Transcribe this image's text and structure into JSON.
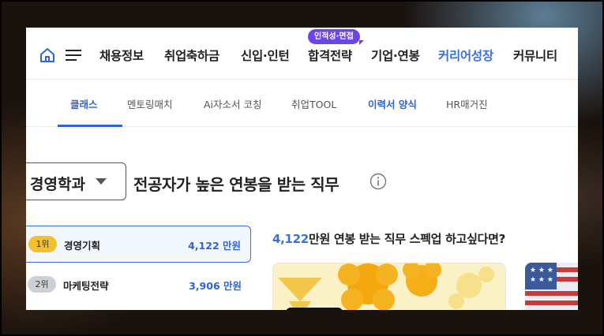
{
  "nav": {
    "items": [
      "채용정보",
      "취업축하금",
      "신입·인턴",
      "합격전략",
      "기업·연봉",
      "커리어성장",
      "커뮤니티"
    ],
    "badge": "인적성·면접"
  },
  "subnav": {
    "items": [
      "클래스",
      "멘토링매치",
      "Ai자소서 코칭",
      "취업TOOL",
      "이력서 양식",
      "HR매거진"
    ]
  },
  "heading": {
    "major": "경영학과",
    "title": "전공자가 높은 연봉을 받는 직무"
  },
  "ranking": [
    {
      "rank": "1위",
      "name": "경영기획",
      "salary": "4,122 만원"
    },
    {
      "rank": "2위",
      "name": "마케팅전략",
      "salary": "3,906 만원"
    }
  ],
  "promo": {
    "number": "4,122",
    "text": "만원 연봉 받는 직무 스펙업 하고싶다면?"
  },
  "colors": {
    "accent": "#3b6fe0",
    "badge": "#6b46e5",
    "gold": "#f4c12b"
  }
}
